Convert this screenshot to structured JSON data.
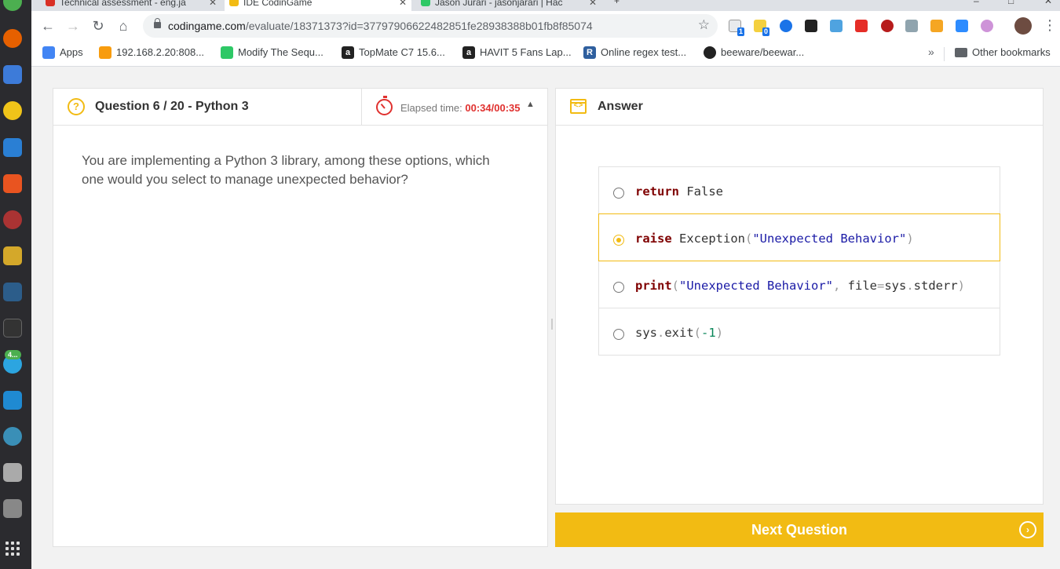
{
  "browser": {
    "tabs": [
      {
        "title": "Technical assessment - eng.ja",
        "fav_color": "#d93025"
      },
      {
        "title": "IDE CodinGame",
        "fav_color": "#f2bb13"
      },
      {
        "title": "Jason Jurari - jasonjarari | Hac",
        "fav_color": "#2ec866"
      }
    ],
    "address": {
      "domain": "codingame.com",
      "path": "/evaluate/18371373?id=37797906622482851fe28938388b01fb8f85074"
    },
    "extension_badges": [
      "1",
      "0"
    ],
    "bookmarks": [
      {
        "label": "Apps",
        "icon": "apps-grid-icon",
        "color": "#4285f4"
      },
      {
        "label": "192.168.2.20:808...",
        "icon": "phpmyadmin-icon",
        "color": "#f89c0e"
      },
      {
        "label": "Modify The Sequ...",
        "icon": "hackerrank-icon",
        "color": "#2ec866"
      },
      {
        "label": "TopMate C7 15.6...",
        "icon": "amazon-icon",
        "color": "#222222"
      },
      {
        "label": "HAVIT 5 Fans Lap...",
        "icon": "amazon-icon",
        "color": "#222222"
      },
      {
        "label": "Online regex test...",
        "icon": "regex-icon",
        "color": "#2f5f9e"
      },
      {
        "label": "beeware/beewar...",
        "icon": "github-icon",
        "color": "#222222"
      }
    ],
    "other_bookmarks": "Other bookmarks"
  },
  "dock": {
    "badge": "4..."
  },
  "question": {
    "header": "Question 6 / 20 - Python 3",
    "elapsed_label": "Elapsed time: ",
    "elapsed_value": "00:34/00:35",
    "text": "You are implementing a Python 3 library, among these options, which one would you select to manage unexpected behavior?"
  },
  "answer": {
    "header": "Answer",
    "options": [
      {
        "tokens": [
          {
            "t": "return",
            "c": "kw"
          },
          {
            "t": " False",
            "c": ""
          }
        ],
        "selected": false
      },
      {
        "tokens": [
          {
            "t": "raise",
            "c": "kw"
          },
          {
            "t": " Exception",
            "c": ""
          },
          {
            "t": "(",
            "c": "punc"
          },
          {
            "t": "\"Unexpected Behavior\"",
            "c": "str"
          },
          {
            "t": ")",
            "c": "punc"
          }
        ],
        "selected": true
      },
      {
        "tokens": [
          {
            "t": "print",
            "c": "kw"
          },
          {
            "t": "(",
            "c": "punc"
          },
          {
            "t": "\"Unexpected Behavior\"",
            "c": "str"
          },
          {
            "t": ", ",
            "c": "punc"
          },
          {
            "t": "file",
            "c": ""
          },
          {
            "t": "=",
            "c": "punc"
          },
          {
            "t": "sys",
            "c": ""
          },
          {
            "t": ".",
            "c": "punc"
          },
          {
            "t": "stderr",
            "c": ""
          },
          {
            "t": ")",
            "c": "punc"
          }
        ],
        "selected": false
      },
      {
        "tokens": [
          {
            "t": "sys",
            "c": ""
          },
          {
            "t": ".",
            "c": "punc"
          },
          {
            "t": "exit",
            "c": ""
          },
          {
            "t": "(",
            "c": "punc"
          },
          {
            "t": "-1",
            "c": "num"
          },
          {
            "t": ")",
            "c": "punc"
          }
        ],
        "selected": false
      }
    ]
  },
  "next_button": "Next Question",
  "colors": {
    "accent": "#f2bb13",
    "timer": "#e0312f"
  }
}
